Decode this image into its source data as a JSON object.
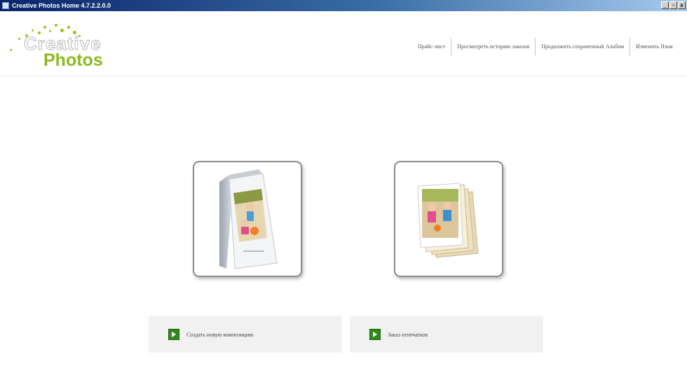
{
  "window": {
    "title": "Creative Photos Home 4.7.2.2.0.0",
    "buttons": [
      "_",
      "▫",
      "x"
    ]
  },
  "logo": {
    "word1": "Creative",
    "word2": "Photos",
    "accent_color": "#8cba1f"
  },
  "nav": {
    "items": [
      {
        "label": "Прайс-лист"
      },
      {
        "label": "Просмотреть историю заказов"
      },
      {
        "label": "Продолжить сохраненный Альбом"
      },
      {
        "label": "Изменить Язык"
      }
    ]
  },
  "tiles": [
    {
      "icon": "photo-book-icon"
    },
    {
      "icon": "photo-prints-icon"
    }
  ],
  "options": [
    {
      "label": "Создать новую композицию",
      "icon": "arrow-right-icon"
    },
    {
      "label": "Заказ отпечатков",
      "icon": "arrow-right-icon"
    }
  ],
  "colors": {
    "titlebar": "#0a246a",
    "button_green": "#2f8a1d",
    "option_bg": "#f1f1f1"
  }
}
